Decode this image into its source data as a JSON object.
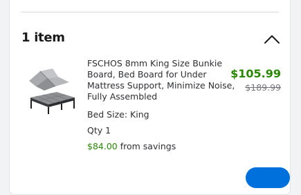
{
  "cart": {
    "header": {
      "count_label": "1 item",
      "toggle_icon": "chevron-up-icon"
    },
    "item": {
      "title": "FSCHOS 8mm King Size Bunkie Board, Bed Board for Under Mattress Support, Minimize Noise, Fully Assembled",
      "option": "Bed Size: King",
      "quantity": "Qty 1",
      "savings_amount": "$84.00",
      "savings_suffix": "from savings",
      "price": "$105.99",
      "was_price": "$189.99",
      "image_icon": "bunkie-board-product-image"
    }
  },
  "colors": {
    "price_green": "#2a8703",
    "accent_blue": "#0071dc",
    "text_dark": "#1a1a1a",
    "text_muted": "#74767c"
  }
}
